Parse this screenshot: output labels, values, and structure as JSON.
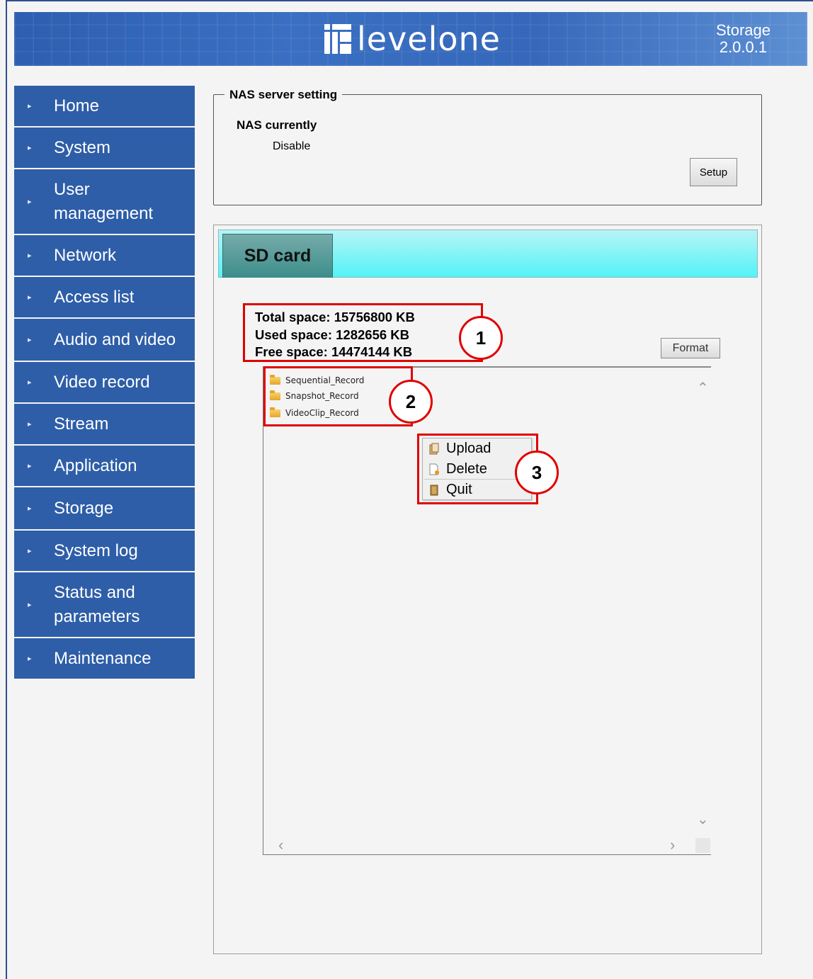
{
  "header": {
    "logo_text": "levelone",
    "section": "Storage",
    "version": "2.0.0.1"
  },
  "sidebar": {
    "items": [
      {
        "label": "Home"
      },
      {
        "label": "System"
      },
      {
        "label": "User management"
      },
      {
        "label": "Network"
      },
      {
        "label": "Access list"
      },
      {
        "label": "Audio and video"
      },
      {
        "label": "Video record"
      },
      {
        "label": "Stream"
      },
      {
        "label": "Application"
      },
      {
        "label": "Storage"
      },
      {
        "label": "System log"
      },
      {
        "label": "Status and parameters"
      },
      {
        "label": "Maintenance"
      }
    ]
  },
  "nas": {
    "legend": "NAS server setting",
    "status_label": "NAS currently",
    "status_value": "Disable",
    "setup_label": "Setup"
  },
  "sd_card": {
    "tab_label": "SD card",
    "total_space": "Total space: 15756800 KB",
    "used_space": "Used space: 1282656 KB",
    "free_space": "Free space: 14474144 KB",
    "format_label": "Format",
    "folders": [
      {
        "name": "Sequential_Record"
      },
      {
        "name": "Snapshot_Record"
      },
      {
        "name": "VideoClip_Record"
      }
    ]
  },
  "context_menu": {
    "upload": "Upload",
    "delete": "Delete",
    "quit": "Quit"
  },
  "callouts": [
    "1",
    "2",
    "3"
  ],
  "icons": {
    "folder": "folder-icon",
    "upload": "upload-icon",
    "delete": "delete-icon",
    "quit": "quit-icon"
  },
  "colors": {
    "sidebar": "#2e5ea8",
    "header": "#3568ba",
    "tab_bar": "#53f3f7",
    "callout": "#e00000"
  }
}
